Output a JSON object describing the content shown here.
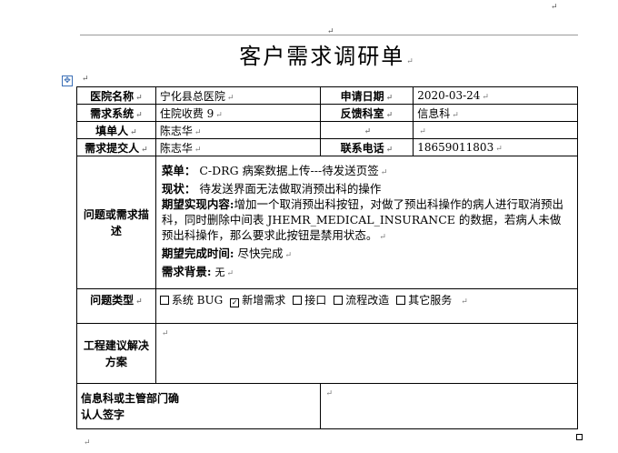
{
  "title": "客户需求调研单",
  "rows": {
    "hospital_label": "医院名称",
    "hospital_value": "宁化县总医院",
    "apply_date_label": "申请日期",
    "apply_date_value": "2020-03-24",
    "system_label": "需求系统",
    "system_value": "住院收费 9",
    "feedback_dept_label": "反馈科室",
    "feedback_dept_value": "信息科",
    "filler_label": "填单人",
    "filler_value": "陈志华",
    "submitter_label": "需求提交人",
    "submitter_value": "陈志华",
    "phone_label": "联系电话",
    "phone_value": "18659011803"
  },
  "description": {
    "label": "问题或需求描述",
    "menu_label": "菜单：",
    "menu_value": "C-DRG 病案数据上传---待发送页签",
    "status_label": "现状：",
    "status_value": "待发送界面无法做取消预出科的操作",
    "expect_label": "期望实现内容:",
    "expect_value": "增加一个取消预出科按钮，对做了预出科操作的病人进行取消预出科，同时删除中间表 JHEMR_MEDICAL_INSURANCE 的数据，若病人未做预出科操作，那么要求此按钮是禁用状态。",
    "deadline_label": "期望完成时间:",
    "deadline_value": "尽快完成",
    "background_label": "需求背景:",
    "background_value": "无"
  },
  "problem_type": {
    "label": "问题类型",
    "options": [
      {
        "text": "系统 BUG",
        "checked": false
      },
      {
        "text": "新增需求",
        "checked": true
      },
      {
        "text": "接口",
        "checked": false
      },
      {
        "text": "流程改造",
        "checked": false
      },
      {
        "text": "其它服务",
        "checked": false
      }
    ]
  },
  "solution": {
    "label": "工程建议解决方案",
    "value": ""
  },
  "signature": {
    "label": "信息科或主管部门确认人签字",
    "value": ""
  }
}
